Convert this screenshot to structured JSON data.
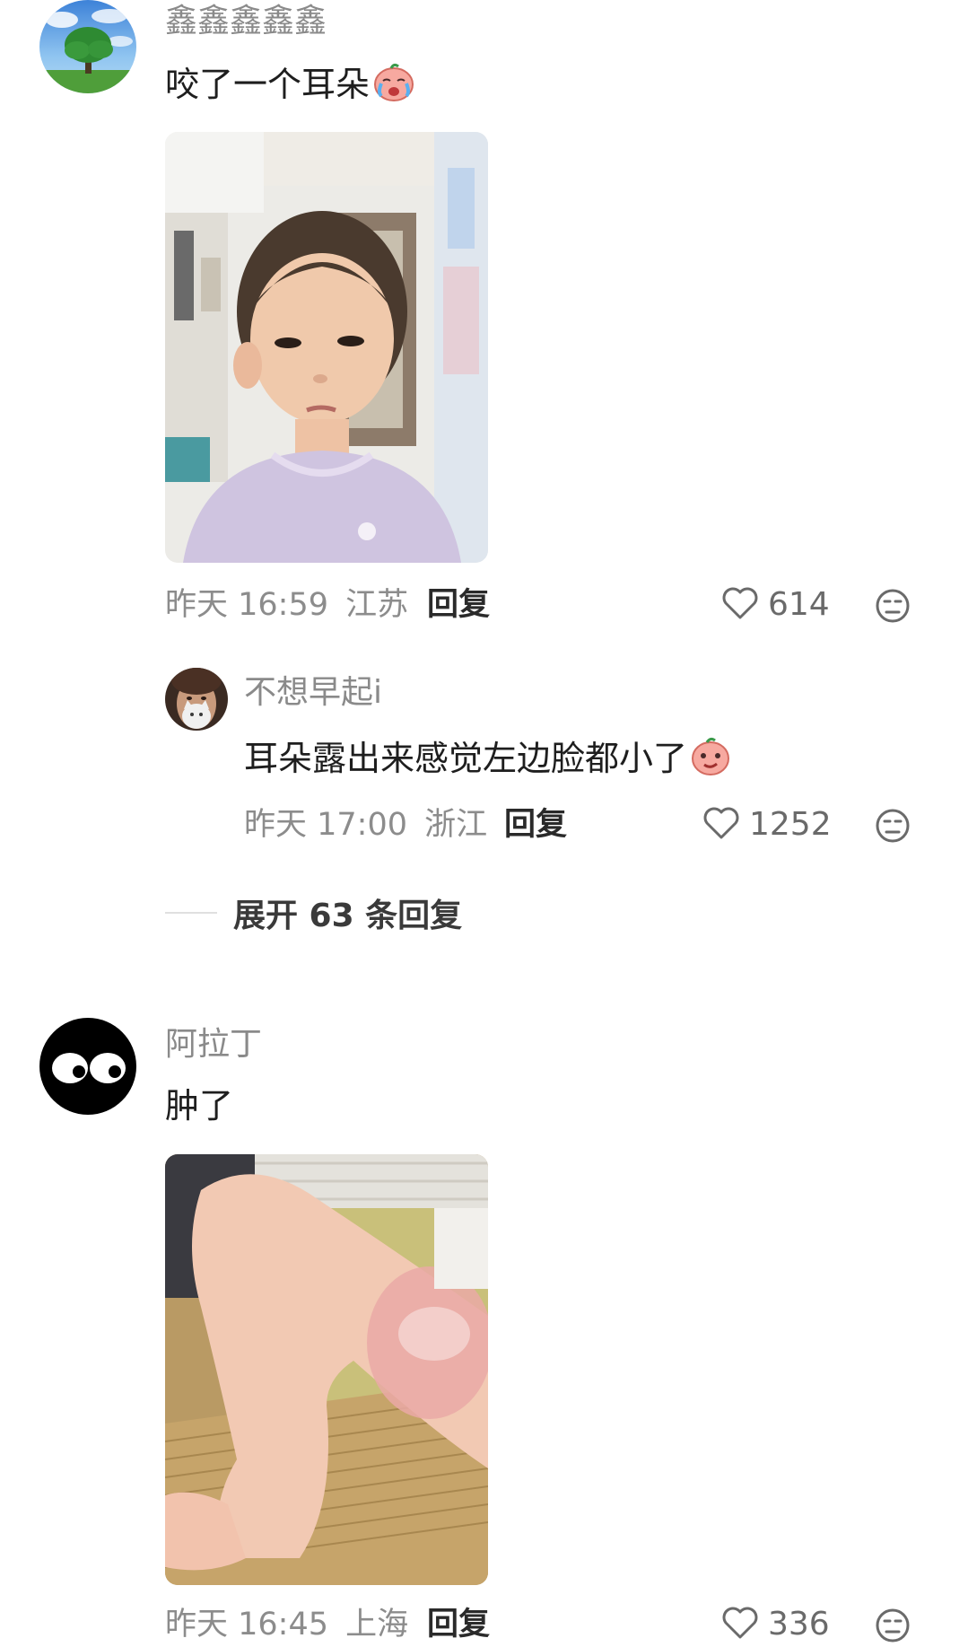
{
  "comments": [
    {
      "username": "鑫鑫鑫鑫鑫",
      "text": "咬了一个耳朵",
      "emoji": "crying-face-icon",
      "time": "昨天 16:59",
      "location": "江苏",
      "reply_label": "回复",
      "likes": "614"
    },
    {
      "username": "阿拉丁",
      "text": "肿了",
      "time": "昨天 16:45",
      "location": "上海",
      "reply_label": "回复",
      "likes": "336"
    }
  ],
  "replies": [
    {
      "username": "不想早起i",
      "text": "耳朵露出来感觉左边脸都小了",
      "emoji": "smirk-face-icon",
      "time": "昨天 17:00",
      "location": "浙江",
      "reply_label": "回复",
      "likes": "1252"
    }
  ],
  "expand_replies_label": "展开 63 条回复",
  "colors": {
    "meta_gray": "#8c8c8c",
    "text_dark": "#1e1e1e",
    "divider": "#e0e0e0"
  }
}
